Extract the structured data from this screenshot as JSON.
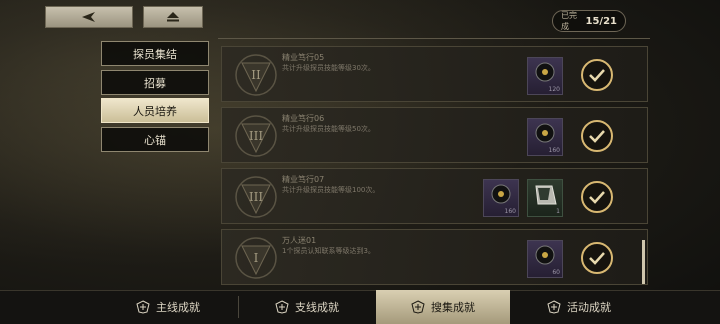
{
  "header": {
    "back_icon": "back-arrow-icon",
    "home_icon": "eject-icon",
    "progress_label": "已完成",
    "progress_count": "15/21"
  },
  "categories": [
    {
      "label": "探员集结",
      "active": false
    },
    {
      "label": "招募",
      "active": false
    },
    {
      "label": "人员培养",
      "active": true
    },
    {
      "label": "心锚",
      "active": false
    }
  ],
  "achievements": [
    {
      "title": "精业笃行05",
      "desc": "共计升级探员技能等级30次。",
      "badge": "II",
      "rewards": [
        "120"
      ],
      "status_icon": "check-icon"
    },
    {
      "title": "精业笃行06",
      "desc": "共计升级探员技能等级50次。",
      "badge": "III",
      "rewards": [
        "160"
      ],
      "status_icon": "check-icon"
    },
    {
      "title": "精业笃行07",
      "desc": "共计升级探员技能等级100次。",
      "badge": "III",
      "rewards": [
        "160",
        "1"
      ],
      "status_icon": "check-icon"
    },
    {
      "title": "万人迷01",
      "desc": "1个探员认知联系等级达到3。",
      "badge": "I",
      "rewards": [
        "60"
      ],
      "status_icon": "check-icon"
    }
  ],
  "tabs": [
    {
      "label": "主线成就",
      "active": false
    },
    {
      "label": "支线成就",
      "active": false
    },
    {
      "label": "搜集成就",
      "active": true
    },
    {
      "label": "活动成就",
      "active": false
    }
  ],
  "colors": {
    "accent_gold": "#d8b872",
    "active_tab": "#d9cfb2",
    "panel_bg": "#1e1c16"
  }
}
